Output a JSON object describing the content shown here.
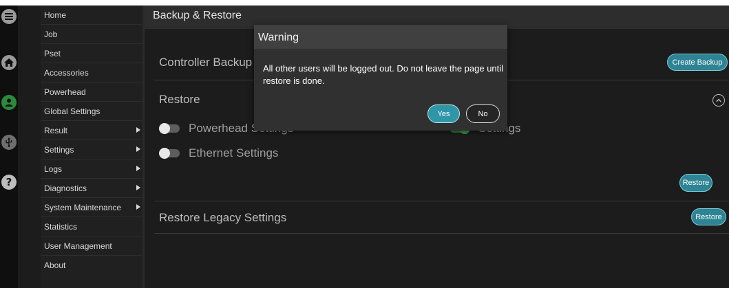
{
  "rail": {
    "icons": [
      "menu-icon",
      "home-icon",
      "user-icon",
      "usb-icon",
      "help-icon"
    ]
  },
  "menu": {
    "items": [
      {
        "label": "Home"
      },
      {
        "label": "Job"
      },
      {
        "label": "Pset"
      },
      {
        "label": "Accessories"
      },
      {
        "label": "Powerhead"
      },
      {
        "label": "Global Settings"
      },
      {
        "label": "Result"
      },
      {
        "label": "Settings"
      },
      {
        "label": "Logs"
      },
      {
        "label": "Diagnostics"
      },
      {
        "label": "System Maintenance"
      },
      {
        "label": "Statistics"
      },
      {
        "label": "User Management"
      },
      {
        "label": "About"
      }
    ]
  },
  "main": {
    "title": "Backup & Restore",
    "controller_backup": {
      "title": "Controller Backup",
      "button": "Create Backup"
    },
    "restore": {
      "title": "Restore",
      "toggles": [
        {
          "label": "Powerhead Settings",
          "on": false
        },
        {
          "label": "Settings",
          "on": true
        },
        {
          "label": "Ethernet Settings",
          "on": false
        }
      ],
      "button": "Restore"
    },
    "legacy": {
      "title": "Restore Legacy Settings",
      "button": "Restore"
    }
  },
  "dialog": {
    "title": "Warning",
    "message": "All other users will be logged out. Do not leave the page until restore is done.",
    "yes": "Yes",
    "no": "No"
  },
  "colors": {
    "accent": "#2e8494",
    "background": "#1c1c1c",
    "toggle_on": "#2e7d3a"
  }
}
